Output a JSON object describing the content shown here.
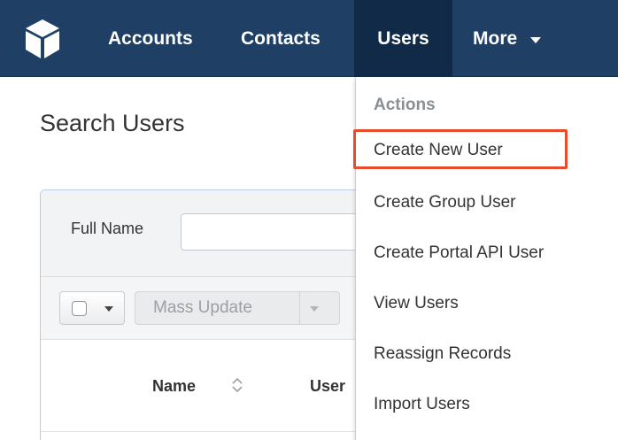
{
  "navbar": {
    "logo_icon": "cube-logo-icon",
    "items": [
      {
        "label": "Accounts"
      },
      {
        "label": "Contacts"
      },
      {
        "label": "Users"
      },
      {
        "label": "More"
      }
    ],
    "active_item": "Users",
    "background_color": "#1f3f64"
  },
  "page": {
    "title": "Search Users"
  },
  "filter": {
    "full_name_label": "Full Name",
    "full_name_value": ""
  },
  "toolbar": {
    "mass_update_label": "Mass Update"
  },
  "table": {
    "columns": [
      "Name",
      "User"
    ]
  },
  "dropdown": {
    "header": "Actions",
    "items": [
      {
        "label": "Create New User"
      },
      {
        "label": "Create Group User"
      },
      {
        "label": "Create Portal API User"
      },
      {
        "label": "View Users"
      },
      {
        "label": "Reassign Records"
      },
      {
        "label": "Import Users"
      }
    ],
    "highlighted_item": "Create New User",
    "highlight_color": "#e84a2c"
  }
}
